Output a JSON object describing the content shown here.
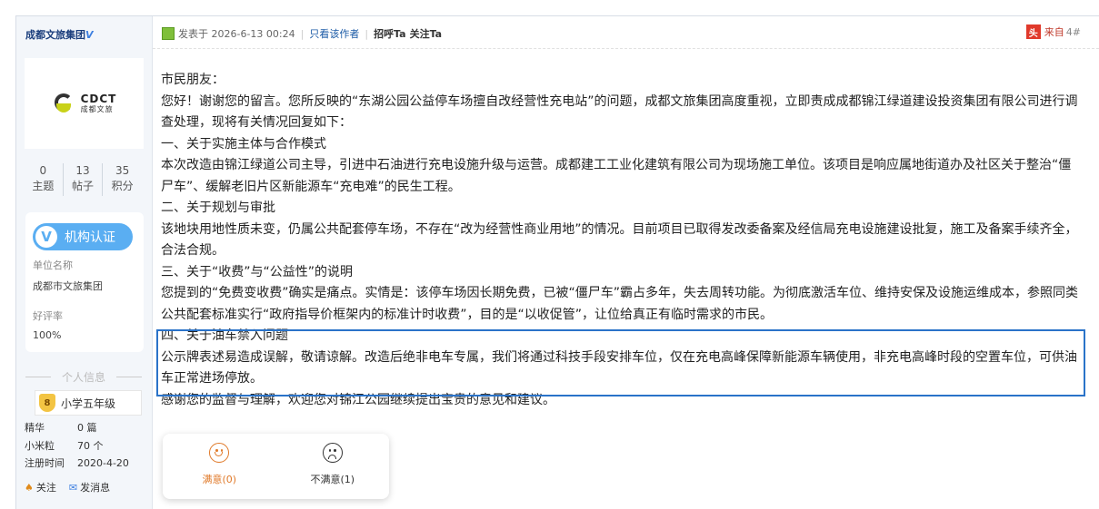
{
  "sidebar": {
    "author": "成都文旅集团",
    "author_badge": "V",
    "logo": {
      "main": "CDCT",
      "sub": "成都文旅"
    },
    "stats": [
      {
        "value": "0",
        "label": "主题"
      },
      {
        "value": "13",
        "label": "帖子"
      },
      {
        "value": "35",
        "label": "积分"
      }
    ],
    "cert": {
      "button": "机构认证",
      "unit_label": "单位名称",
      "unit_value": "成都市文旅集团",
      "rating_label": "好评率",
      "rating_value": "100%"
    },
    "info_title": "个人信息",
    "level": {
      "badge": "8",
      "name": "小学五年级"
    },
    "meta": [
      {
        "label": "精华",
        "value": "0 篇"
      },
      {
        "label": "小米粒",
        "value": "70 个"
      },
      {
        "label": "注册时间",
        "value": "2020-4-20"
      }
    ],
    "actions": {
      "follow": "关注",
      "message": "发消息"
    }
  },
  "post_header": {
    "posted": "发表于 2026-6-13 00:24",
    "only_author": "只看该作者",
    "greet": "招呼Ta",
    "follow": "关注Ta",
    "source": "来自",
    "floor": "4#"
  },
  "content": {
    "paragraphs": [
      "市民朋友：",
      "您好！谢谢您的留言。您所反映的“东湖公园公益停车场擅自改经营性充电站”的问题，成都文旅集团高度重视，立即责成成都锦江绿道建设投资集团有限公司进行调查处理，现将有关情况回复如下：",
      "一、关于实施主体与合作模式",
      "本次改造由锦江绿道公司主导，引进中石油进行充电设施升级与运营。成都建工工业化建筑有限公司为现场施工单位。该项目是响应属地街道办及社区关于整治“僵尸车”、缓解老旧片区新能源车“充电难”的民生工程。",
      "二、关于规划与审批",
      "该地块用地性质未变，仍属公共配套停车场，不存在“改为经营性商业用地”的情况。目前项目已取得发改委备案及经信局充电设施建设批复，施工及备案手续齐全，合法合规。",
      "三、关于“收费”与“公益性”的说明",
      "您提到的“免费变收费”确实是痛点。实情是：该停车场因长期免费，已被“僵尸车”霸占多年，失去周转功能。为彻底激活车位、维持安保及设施运维成本，参照同类公共配套标准实行“政府指导价框架内的标准计时收费”，目的是“以收促管”，让位给真正有临时需求的市民。",
      "四、关于油车禁入问题",
      "公示牌表述易造成误解，敬请谅解。改造后绝非电车专属，我们将通过科技手段安排车位，仅在充电高峰保障新能源车辆使用，非充电高峰时段的空置车位，可供油车正常进场停放。",
      "感谢您的监督与理解，欢迎您对锦江公园继续提出宝贵的意见和建议。"
    ]
  },
  "rating": {
    "satisfied": "满意(0)",
    "unsatisfied": "不满意(1)"
  }
}
